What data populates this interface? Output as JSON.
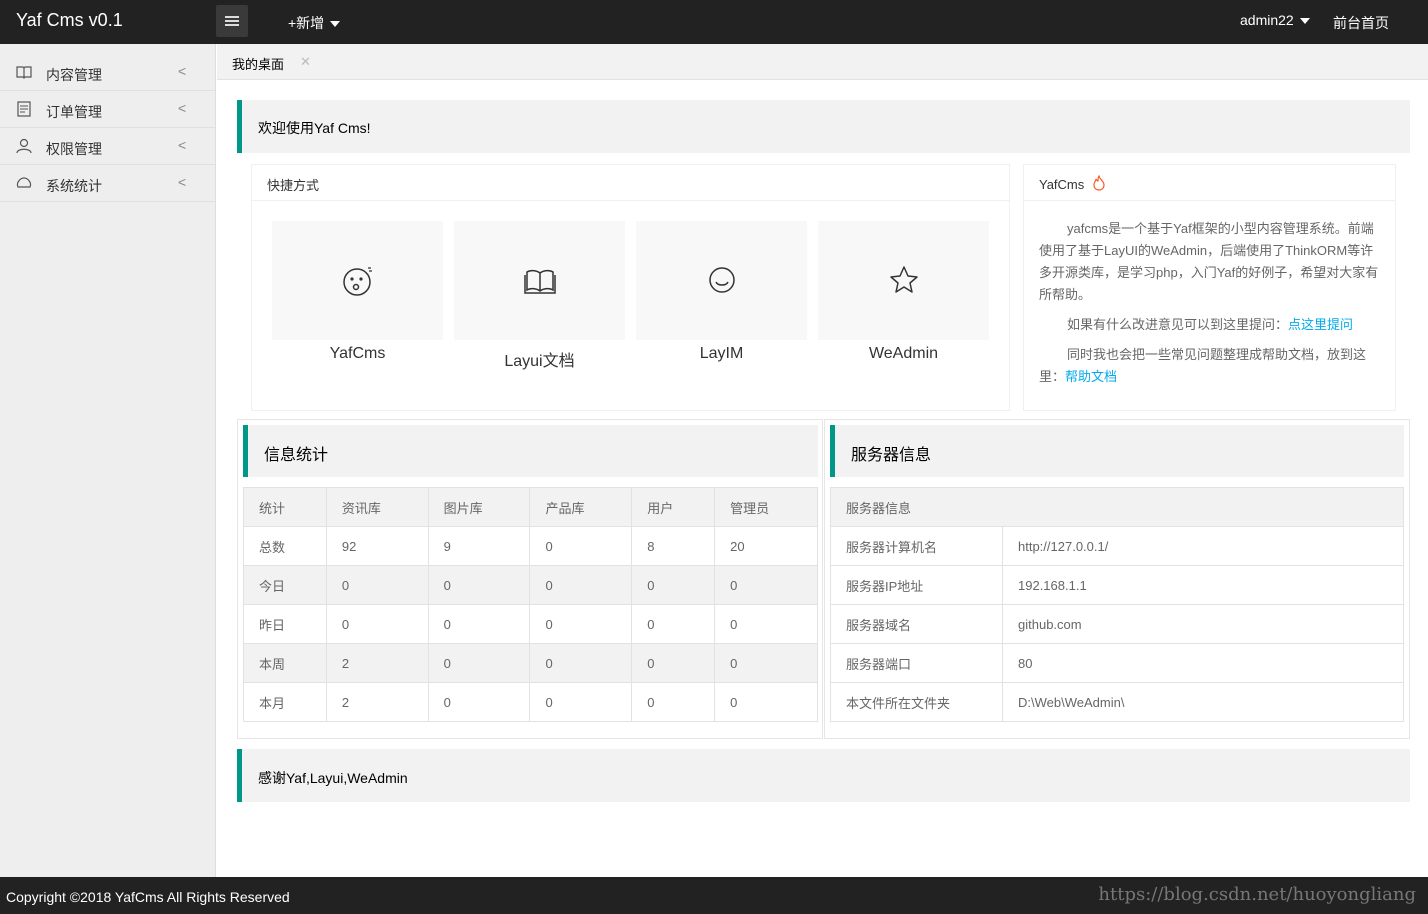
{
  "header": {
    "logo": "Yaf Cms v0.1",
    "add_new": "+新增",
    "user": "admin22",
    "front_home": "前台首页"
  },
  "sidebar": {
    "items": [
      {
        "label": "内容管理",
        "icon": "book-icon"
      },
      {
        "label": "订单管理",
        "icon": "order-list-icon"
      },
      {
        "label": "权限管理",
        "icon": "user-icon"
      },
      {
        "label": "系统统计",
        "icon": "stats-icon"
      }
    ]
  },
  "tabs": [
    {
      "label": "我的桌面",
      "close": "✕"
    }
  ],
  "welcome": "欢迎使用Yaf Cms!",
  "shortcuts": {
    "title": "快捷方式",
    "items": [
      {
        "label": "YafCms",
        "icon": "surprised-face-icon"
      },
      {
        "label": "Layui文档",
        "icon": "book-open-icon"
      },
      {
        "label": "LayIM",
        "icon": "smile-icon"
      },
      {
        "label": "WeAdmin",
        "icon": "star-icon"
      }
    ]
  },
  "about": {
    "title": "YafCms",
    "p1": "yafcms是一个基于Yaf框架的小型内容管理系统。前端使用了基于LayUI的WeAdmin，后端使用了ThinkORM等许多开源类库，是学习php，入门Yaf的好例子，希望对大家有所帮助。",
    "p2_text": "如果有什么改进意见可以到这里提问：",
    "p2_link": "点这里提问",
    "p3_text": "同时我也会把一些常见问题整理成帮助文档，放到这里：",
    "p3_link": "帮助文档"
  },
  "stats": {
    "title": "信息统计",
    "columns": [
      "统计",
      "资讯库",
      "图片库",
      "产品库",
      "用户",
      "管理员"
    ],
    "rows": [
      [
        "总数",
        "92",
        "9",
        "0",
        "8",
        "20"
      ],
      [
        "今日",
        "0",
        "0",
        "0",
        "0",
        "0"
      ],
      [
        "昨日",
        "0",
        "0",
        "0",
        "0",
        "0"
      ],
      [
        "本周",
        "2",
        "0",
        "0",
        "0",
        "0"
      ],
      [
        "本月",
        "2",
        "0",
        "0",
        "0",
        "0"
      ]
    ]
  },
  "server": {
    "title": "服务器信息",
    "header": "服务器信息",
    "rows": [
      [
        "服务器计算机名",
        "http://127.0.0.1/"
      ],
      [
        "服务器IP地址",
        "192.168.1.1"
      ],
      [
        "服务器域名",
        "github.com"
      ],
      [
        "服务器端口",
        "80"
      ],
      [
        "本文件所在文件夹",
        "D:\\Web\\WeAdmin\\"
      ]
    ]
  },
  "thanks": "感谢Yaf,Layui,WeAdmin",
  "footer": {
    "copyright": "Copyright ©2018 YafCms All Rights Reserved",
    "watermark": "https://blog.csdn.net/huoyongliang"
  },
  "colors": {
    "accent": "#009688",
    "topbar": "#222222",
    "link": "#01AAED"
  }
}
